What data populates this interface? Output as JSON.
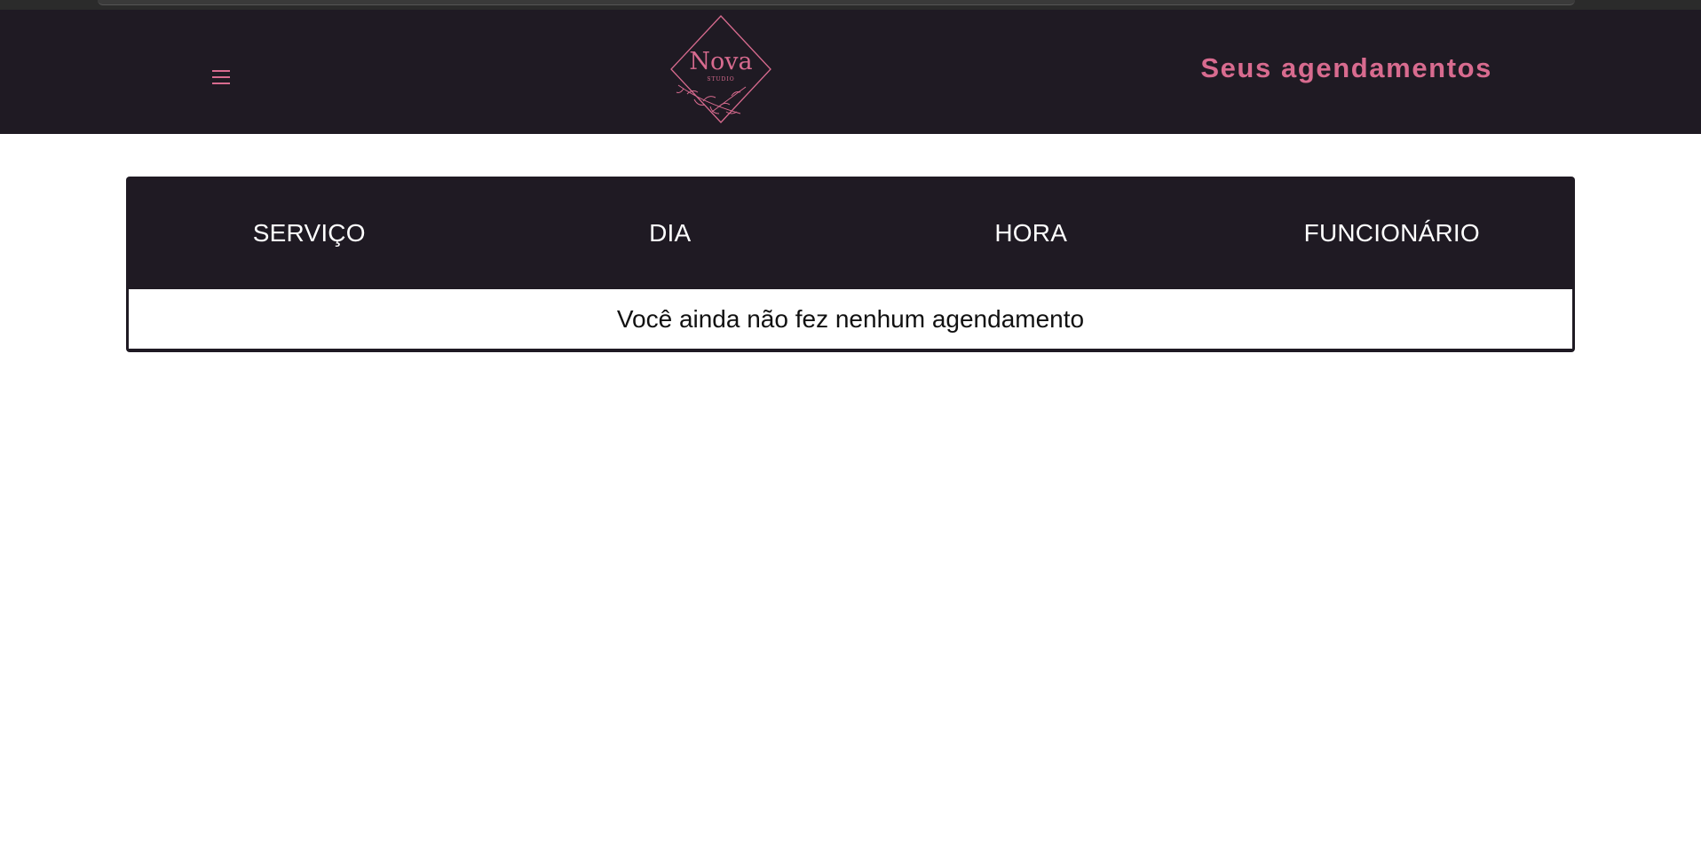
{
  "header": {
    "menu_icon": "hamburger-menu-icon",
    "logo": {
      "name": "Nova",
      "tagline": "STUDIO"
    },
    "title": "Seus agendamentos"
  },
  "table": {
    "columns": [
      "SERVIÇO",
      "DIA",
      "HORA",
      "FUNCIONÁRIO"
    ],
    "empty_message": "Você ainda não fez nenhum agendamento"
  },
  "colors": {
    "navbar_bg": "#1f1a23",
    "accent_pink": "#d86b8f",
    "header_text": "#ffffff",
    "body_bg": "#ffffff"
  }
}
